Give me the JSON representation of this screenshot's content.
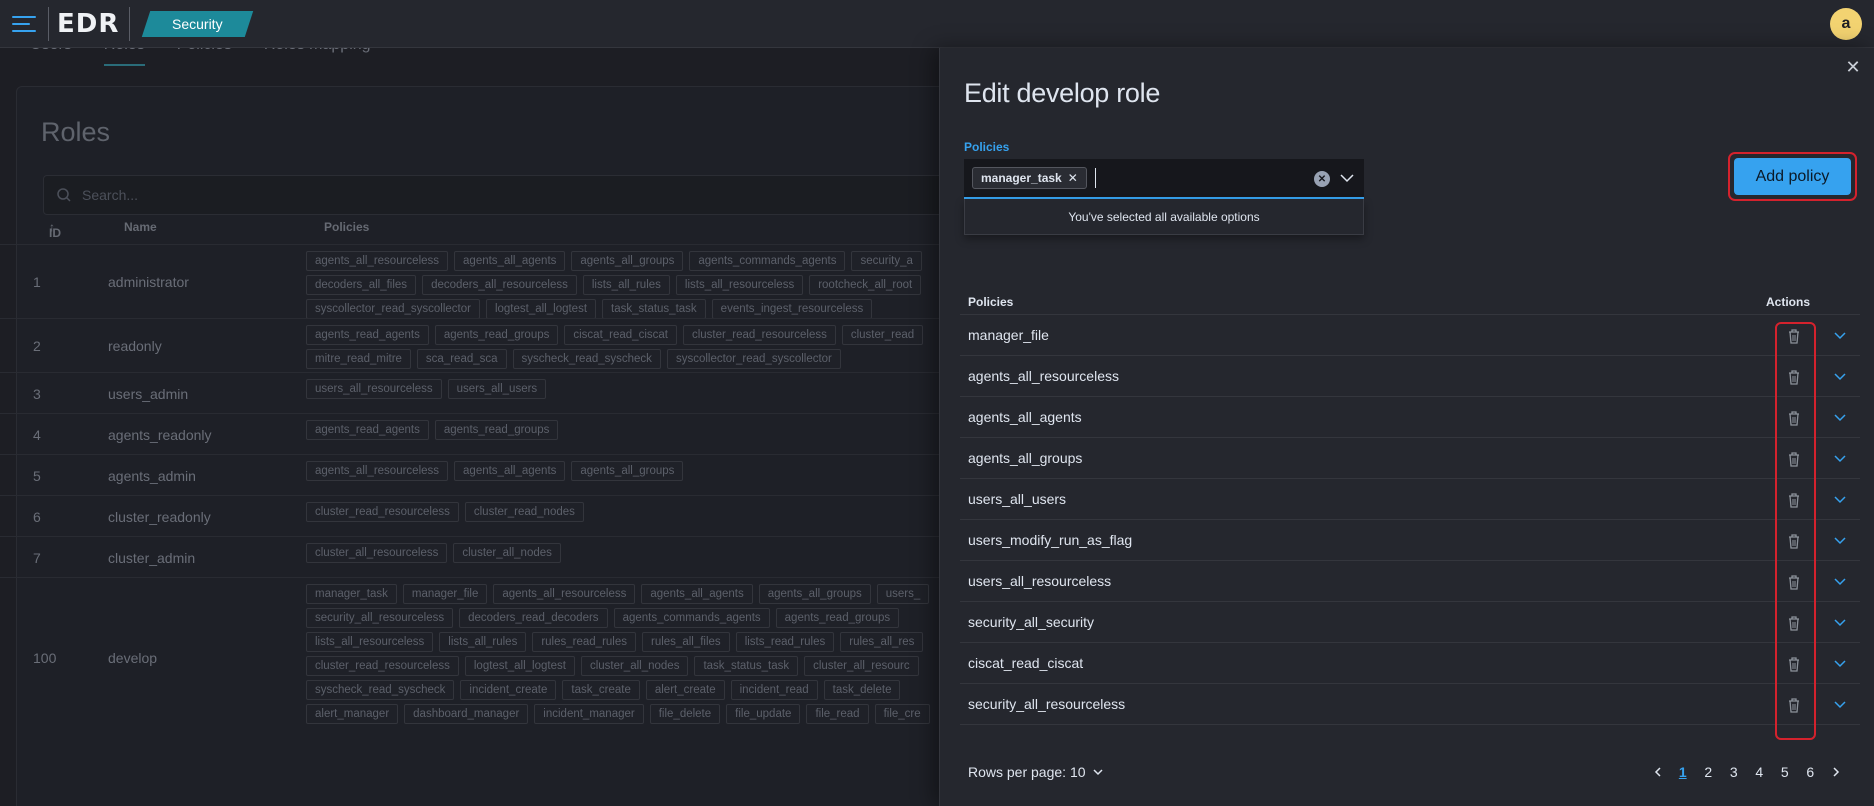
{
  "app": {
    "logo": "EDR",
    "section": "Security",
    "avatar_letter": "a"
  },
  "background": {
    "tabs": [
      "Users",
      "Roles",
      "Policies",
      "Roles mapping"
    ],
    "title": "Roles",
    "search_placeholder": "Search...",
    "columns": {
      "id": "ID",
      "name": "Name",
      "policies": "Policies"
    },
    "rows": [
      {
        "id": "1",
        "name": "administrator",
        "height": 74,
        "policies": [
          "agents_all_resourceless",
          "agents_all_agents",
          "agents_all_groups",
          "agents_commands_agents",
          "security_a",
          "decoders_all_files",
          "decoders_all_resourceless",
          "lists_all_rules",
          "lists_all_resourceless",
          "rootcheck_all_root",
          "syscollector_read_syscollector",
          "logtest_all_logtest",
          "task_status_task",
          "events_ingest_resourceless"
        ]
      },
      {
        "id": "2",
        "name": "readonly",
        "height": 54,
        "policies": [
          "agents_read_agents",
          "agents_read_groups",
          "ciscat_read_ciscat",
          "cluster_read_resourceless",
          "cluster_read",
          "mitre_read_mitre",
          "sca_read_sca",
          "syscheck_read_syscheck",
          "syscollector_read_syscollector"
        ]
      },
      {
        "id": "3",
        "name": "users_admin",
        "height": 41,
        "policies": [
          "users_all_resourceless",
          "users_all_users"
        ]
      },
      {
        "id": "4",
        "name": "agents_readonly",
        "height": 41,
        "policies": [
          "agents_read_agents",
          "agents_read_groups"
        ]
      },
      {
        "id": "5",
        "name": "agents_admin",
        "height": 41,
        "policies": [
          "agents_all_resourceless",
          "agents_all_agents",
          "agents_all_groups"
        ]
      },
      {
        "id": "6",
        "name": "cluster_readonly",
        "height": 41,
        "policies": [
          "cluster_read_resourceless",
          "cluster_read_nodes"
        ]
      },
      {
        "id": "7",
        "name": "cluster_admin",
        "height": 41,
        "policies": [
          "cluster_all_resourceless",
          "cluster_all_nodes"
        ]
      },
      {
        "id": "100",
        "name": "develop",
        "height": 160,
        "policies": [
          "manager_task",
          "manager_file",
          "agents_all_resourceless",
          "agents_all_agents",
          "agents_all_groups",
          "users_",
          "security_all_resourceless",
          "decoders_read_decoders",
          "agents_commands_agents",
          "agents_read_groups",
          "lists_all_resourceless",
          "lists_all_rules",
          "rules_read_rules",
          "rules_all_files",
          "lists_read_rules",
          "rules_all_res",
          "cluster_read_resourceless",
          "logtest_all_logtest",
          "cluster_all_nodes",
          "task_status_task",
          "cluster_all_resourc",
          "syscheck_read_syscheck",
          "incident_create",
          "task_create",
          "alert_create",
          "incident_read",
          "task_delete",
          "alert_manager",
          "dashboard_manager",
          "incident_manager",
          "file_delete",
          "file_update",
          "file_read",
          "file_cre"
        ]
      }
    ]
  },
  "flyout": {
    "title": "Edit develop role",
    "policies_label": "Policies",
    "selected_pill": "manager_task",
    "dropdown_message": "You've selected all available options",
    "add_button": "Add policy",
    "table": {
      "col_policies": "Policies",
      "col_actions": "Actions",
      "rows": [
        "manager_file",
        "agents_all_resourceless",
        "agents_all_agents",
        "agents_all_groups",
        "users_all_users",
        "users_modify_run_as_flag",
        "users_all_resourceless",
        "security_all_security",
        "ciscat_read_ciscat",
        "security_all_resourceless"
      ]
    },
    "pagination": {
      "rows_per_page": "Rows per page: 10",
      "pages": [
        "1",
        "2",
        "3",
        "4",
        "5",
        "6"
      ],
      "active_page": "1"
    }
  },
  "colors": {
    "accent": "#36a2ef",
    "highlight": "#d4222d",
    "section_badge": "#1d8a9a",
    "avatar": "#f3d371"
  }
}
